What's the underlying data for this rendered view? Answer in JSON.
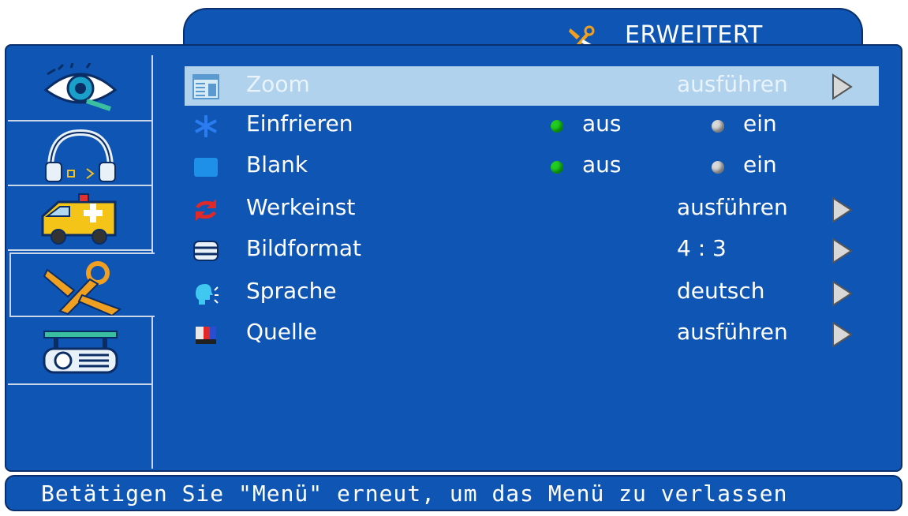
{
  "title": "ERWEITERT",
  "sidebar": {
    "items": [
      {
        "icon": "eye-icon"
      },
      {
        "icon": "headphones-icon"
      },
      {
        "icon": "ambulance-icon"
      },
      {
        "icon": "tools-icon",
        "active": true
      },
      {
        "icon": "projector-icon"
      }
    ]
  },
  "menu": {
    "zoom": {
      "label": "Zoom",
      "value": "ausführen",
      "selected": true
    },
    "einfrieren": {
      "label": "Einfrieren",
      "opt_off": "aus",
      "opt_on": "ein",
      "selected_option": "aus"
    },
    "blank": {
      "label": "Blank",
      "opt_off": "aus",
      "opt_on": "ein",
      "selected_option": "aus"
    },
    "werkeinst": {
      "label": "Werkeinst",
      "value": "ausführen"
    },
    "bildformat": {
      "label": "Bildformat",
      "value": "4 : 3"
    },
    "sprache": {
      "label": "Sprache",
      "value": "deutsch"
    },
    "quelle": {
      "label": "Quelle",
      "value": "ausführen"
    }
  },
  "footer": {
    "hint": "Betätigen Sie \"Menü\" erneut, um das Menü zu verlassen"
  },
  "colors": {
    "panel": "#0f55b4",
    "highlight": "#b0d2ec",
    "dot_active": "#22cc22",
    "dot_inactive": "#d8d8d8"
  }
}
